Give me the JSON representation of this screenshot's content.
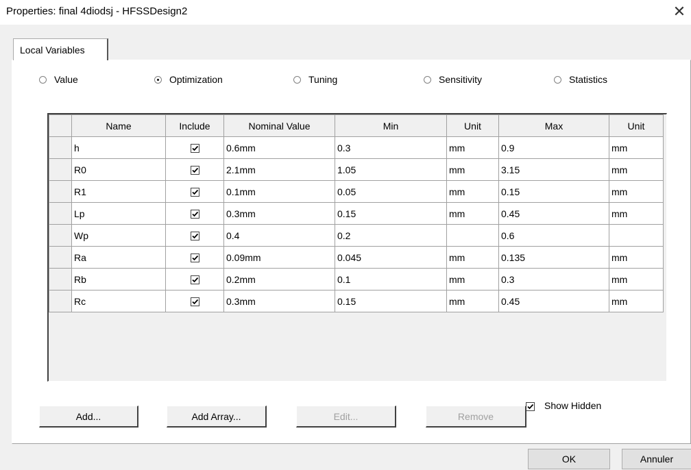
{
  "window": {
    "title": "Properties: final 4diodsj - HFSSDesign2",
    "close_icon": "close-icon"
  },
  "tab": {
    "label": "Local Variables"
  },
  "modes": [
    {
      "label": "Value",
      "selected": false
    },
    {
      "label": "Optimization",
      "selected": true
    },
    {
      "label": "Tuning",
      "selected": false
    },
    {
      "label": "Sensitivity",
      "selected": false
    },
    {
      "label": "Statistics",
      "selected": false
    }
  ],
  "table": {
    "columns": [
      "Name",
      "Include",
      "Nominal Value",
      "Min",
      "Unit",
      "Max",
      "Unit"
    ],
    "rows": [
      {
        "name": "h",
        "include": true,
        "nominal": "0.6mm",
        "min": "0.3",
        "min_unit": "mm",
        "max": "0.9",
        "max_unit": "mm"
      },
      {
        "name": "R0",
        "include": true,
        "nominal": "2.1mm",
        "min": "1.05",
        "min_unit": "mm",
        "max": "3.15",
        "max_unit": "mm"
      },
      {
        "name": "R1",
        "include": true,
        "nominal": "0.1mm",
        "min": "0.05",
        "min_unit": "mm",
        "max": "0.15",
        "max_unit": "mm"
      },
      {
        "name": "Lp",
        "include": true,
        "nominal": "0.3mm",
        "min": "0.15",
        "min_unit": "mm",
        "max": "0.45",
        "max_unit": "mm"
      },
      {
        "name": "Wp",
        "include": true,
        "nominal": "0.4",
        "min": "0.2",
        "min_unit": "",
        "max": "0.6",
        "max_unit": ""
      },
      {
        "name": "Ra",
        "include": true,
        "nominal": "0.09mm",
        "min": "0.045",
        "min_unit": "mm",
        "max": "0.135",
        "max_unit": "mm"
      },
      {
        "name": "Rb",
        "include": true,
        "nominal": "0.2mm",
        "min": "0.1",
        "min_unit": "mm",
        "max": "0.3",
        "max_unit": "mm"
      },
      {
        "name": "Rc",
        "include": true,
        "nominal": "0.3mm",
        "min": "0.15",
        "min_unit": "mm",
        "max": "0.45",
        "max_unit": "mm"
      }
    ]
  },
  "buttons": {
    "add": "Add...",
    "add_array": "Add Array...",
    "edit": "Edit...",
    "remove": "Remove",
    "show_hidden": "Show Hidden",
    "show_hidden_checked": true,
    "ok": "OK",
    "cancel": "Annuler"
  }
}
